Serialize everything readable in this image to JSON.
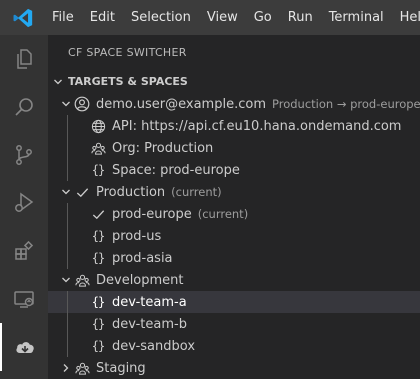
{
  "menu": [
    "File",
    "Edit",
    "Selection",
    "View",
    "Go",
    "Run",
    "Terminal",
    "Help"
  ],
  "sidebar": {
    "title": "CF SPACE SWITCHER",
    "section_title": "TARGETS & SPACES"
  },
  "tree": {
    "user": {
      "label": "demo.user@example.com",
      "description": "Production → prod-europe"
    },
    "api": {
      "label": "API: https://api.cf.eu10.hana.ondemand.com"
    },
    "org": {
      "label": "Org: Production"
    },
    "space": {
      "label": "Space: prod-europe"
    },
    "orgs": [
      {
        "label": "Production",
        "description": "(current)",
        "spaces": [
          {
            "label": "prod-europe",
            "description": "(current)"
          },
          {
            "label": "prod-us"
          },
          {
            "label": "prod-asia"
          }
        ]
      },
      {
        "label": "Development",
        "spaces": [
          {
            "label": "dev-team-a"
          },
          {
            "label": "dev-team-b"
          },
          {
            "label": "dev-sandbox"
          }
        ]
      },
      {
        "label": "Staging"
      }
    ]
  },
  "colors": {
    "menubar_bg": "#3c3c3c",
    "activitybar_bg": "#333333",
    "sidebar_bg": "#252526",
    "selection_bg": "#37373d",
    "vscode_blue": "#23a9f2"
  }
}
